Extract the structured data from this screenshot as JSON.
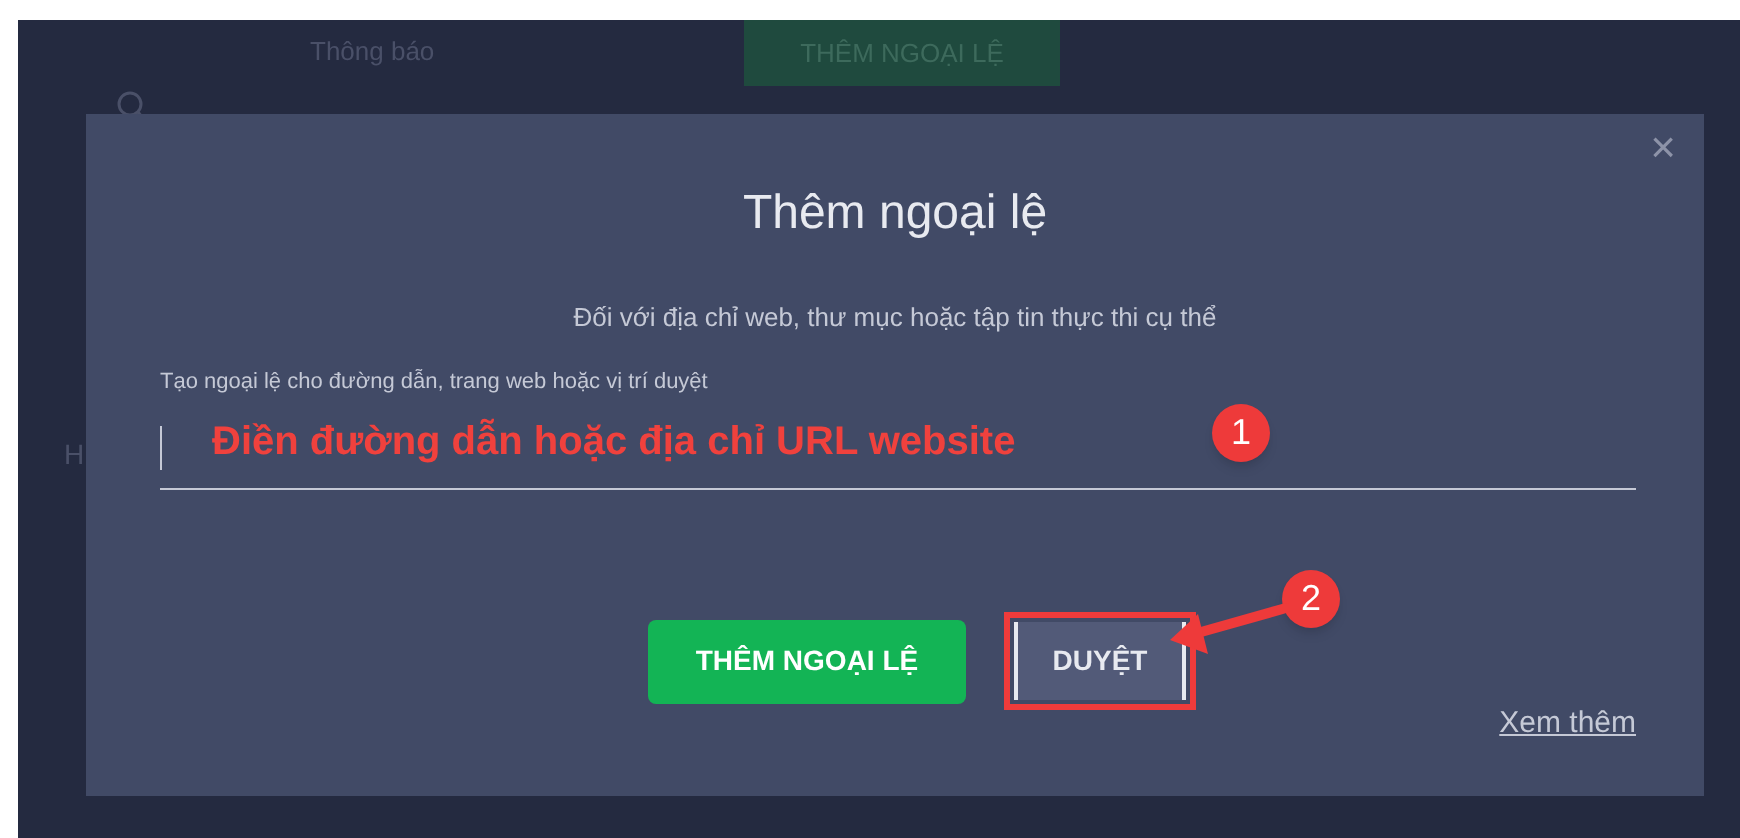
{
  "background": {
    "tab_label": "Thông báo",
    "add_button": "THÊM NGOẠI LỆ",
    "side_letter": "H"
  },
  "dialog": {
    "title": "Thêm ngoại lệ",
    "close": "×",
    "subtitle": "Đối với địa chỉ web, thư mục hoặc tập tin thực thi cụ thể",
    "field": {
      "label": "Tạo ngoại lệ cho đường dẫn, trang web hoặc vị trí duyệt"
    },
    "buttons": [
      {
        "kind": "primary",
        "label": "THÊM NGOẠI LỆ",
        "highlighted": false
      },
      {
        "kind": "secondary",
        "label": "DUYỆT",
        "highlighted": true
      }
    ],
    "link": "Xem thêm"
  },
  "annotations": [
    {
      "kind": "text",
      "text": "Điền đường dẫn hoặc địa chỉ URL website"
    },
    {
      "kind": "step",
      "text": "1"
    },
    {
      "kind": "step",
      "text": "2"
    }
  ]
}
